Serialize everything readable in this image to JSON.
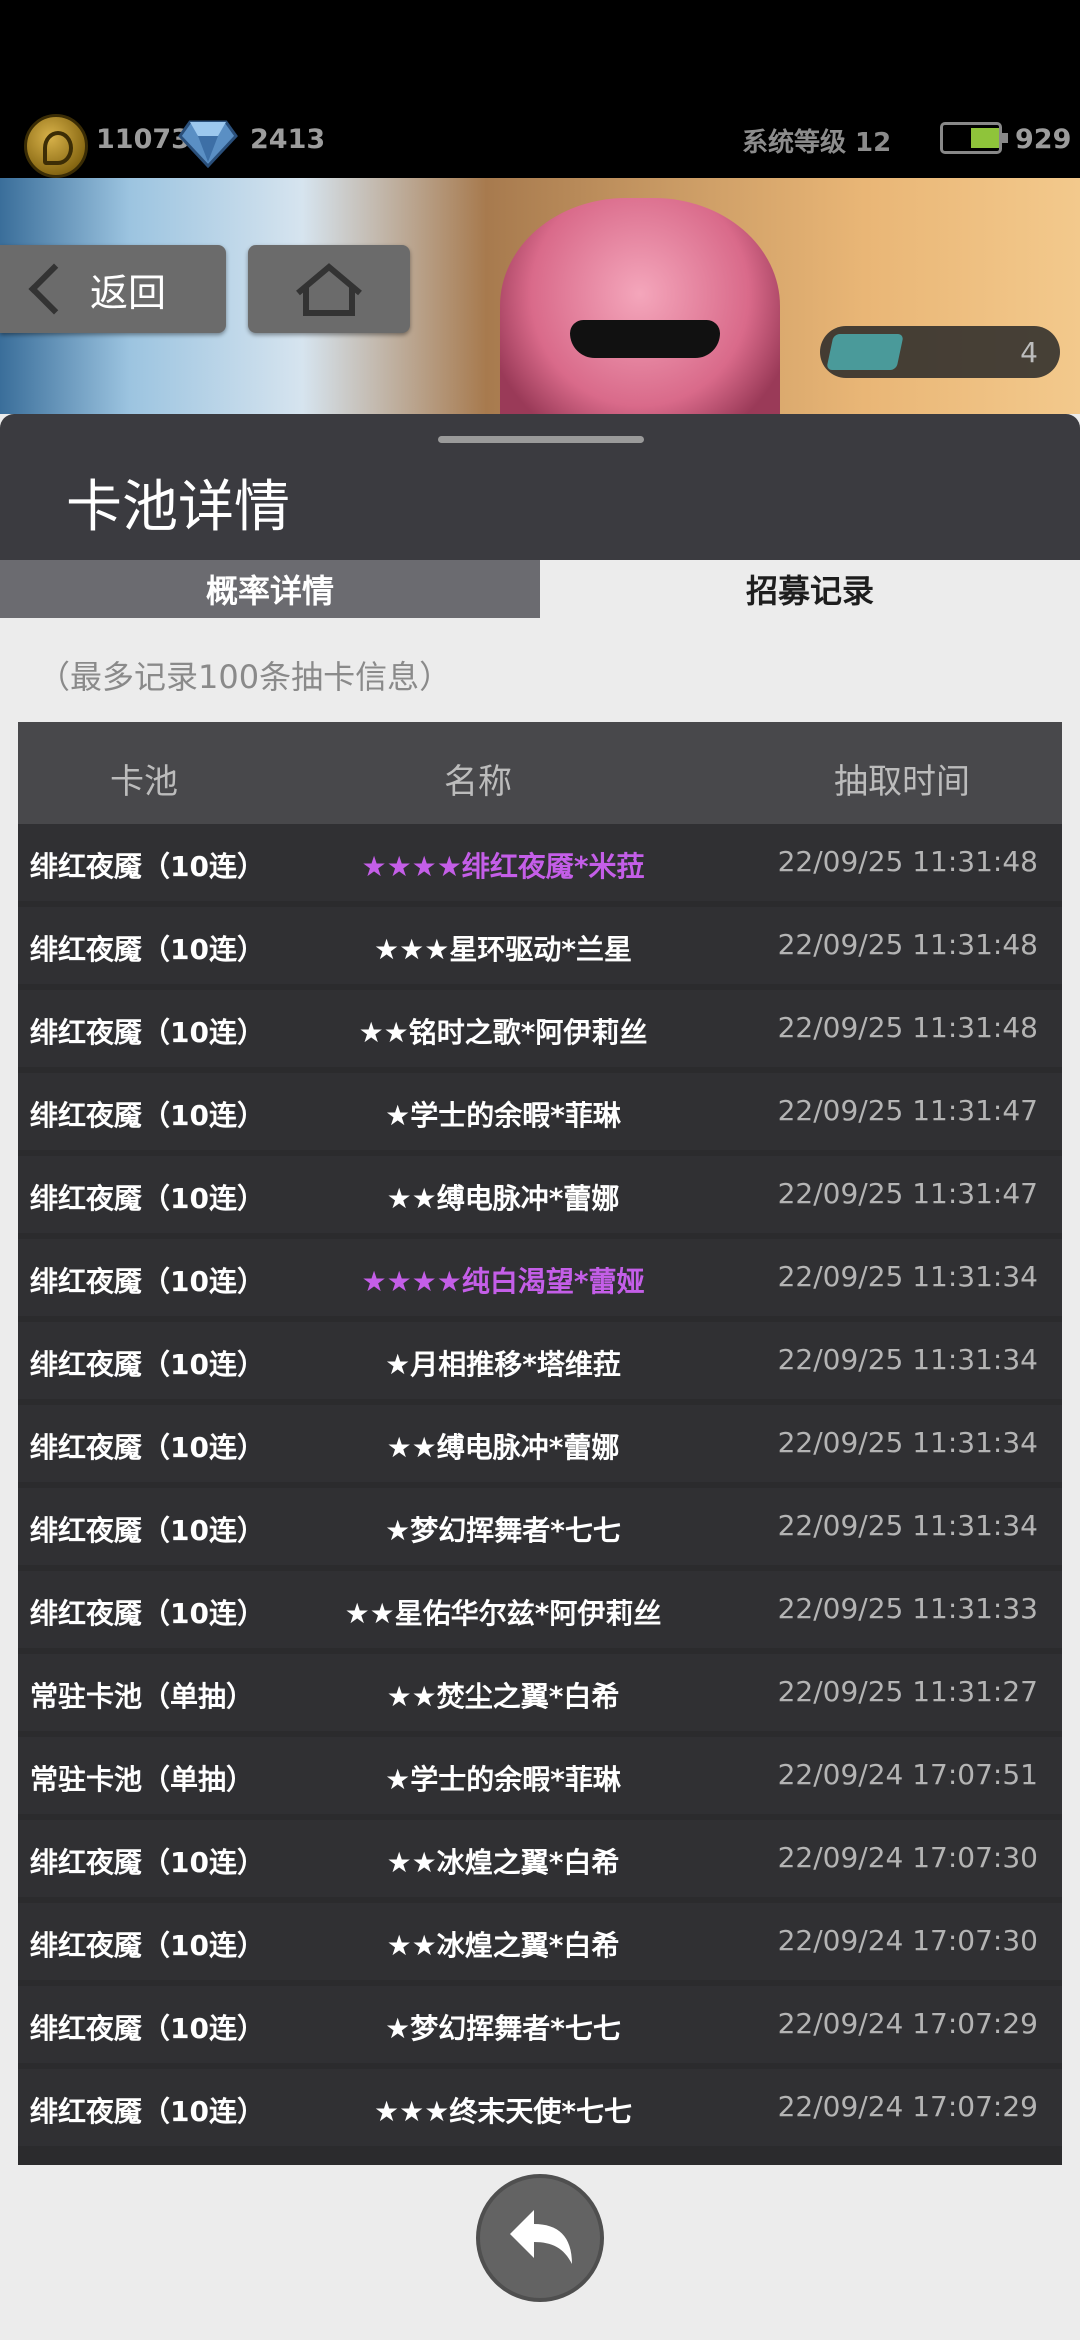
{
  "topbar": {
    "coins": "11073",
    "gems": "2413",
    "system_level": "系统等级 12",
    "energy": "929"
  },
  "banner": {
    "back_label": "返回",
    "ticket_count": "4"
  },
  "dialog": {
    "title": "卡池详情",
    "tabs": [
      "概率详情",
      "招募记录"
    ],
    "active_tab": "招募记录",
    "note": "（最多记录100条抽卡信息）"
  },
  "table": {
    "headers": [
      "卡池",
      "名称",
      "抽取时间"
    ],
    "rows": [
      {
        "pool": "绯红夜魇（10连）",
        "name": "★★★★绯红夜魇*米菈",
        "time": "22/09/25 11:31:48",
        "highlight": true
      },
      {
        "pool": "绯红夜魇（10连）",
        "name": "★★★星环驱动*兰星",
        "time": "22/09/25 11:31:48",
        "highlight": false
      },
      {
        "pool": "绯红夜魇（10连）",
        "name": "★★铭时之歌*阿伊莉丝",
        "time": "22/09/25 11:31:48",
        "highlight": false
      },
      {
        "pool": "绯红夜魇（10连）",
        "name": "★学士的余暇*菲琳",
        "time": "22/09/25 11:31:47",
        "highlight": false
      },
      {
        "pool": "绯红夜魇（10连）",
        "name": "★★缚电脉冲*蕾娜",
        "time": "22/09/25 11:31:47",
        "highlight": false
      },
      {
        "pool": "绯红夜魇（10连）",
        "name": "★★★★纯白渴望*蕾娅",
        "time": "22/09/25 11:31:34",
        "highlight": true
      },
      {
        "pool": "绯红夜魇（10连）",
        "name": "★月相推移*塔维菈",
        "time": "22/09/25 11:31:34",
        "highlight": false
      },
      {
        "pool": "绯红夜魇（10连）",
        "name": "★★缚电脉冲*蕾娜",
        "time": "22/09/25 11:31:34",
        "highlight": false
      },
      {
        "pool": "绯红夜魇（10连）",
        "name": "★梦幻挥舞者*七七",
        "time": "22/09/25 11:31:34",
        "highlight": false
      },
      {
        "pool": "绯红夜魇（10连）",
        "name": "★★星佑华尔兹*阿伊莉丝",
        "time": "22/09/25 11:31:33",
        "highlight": false
      },
      {
        "pool": "常驻卡池（单抽）",
        "name": "★★焚尘之翼*白希",
        "time": "22/09/25 11:31:27",
        "highlight": false
      },
      {
        "pool": "常驻卡池（单抽）",
        "name": "★学士的余暇*菲琳",
        "time": "22/09/24 17:07:51",
        "highlight": false
      },
      {
        "pool": "绯红夜魇（10连）",
        "name": "★★冰煌之翼*白希",
        "time": "22/09/24 17:07:30",
        "highlight": false
      },
      {
        "pool": "绯红夜魇（10连）",
        "name": "★★冰煌之翼*白希",
        "time": "22/09/24 17:07:30",
        "highlight": false
      },
      {
        "pool": "绯红夜魇（10连）",
        "name": "★梦幻挥舞者*七七",
        "time": "22/09/24 17:07:29",
        "highlight": false
      },
      {
        "pool": "绯红夜魇（10连）",
        "name": "★★★终末天使*七七",
        "time": "22/09/24 17:07:29",
        "highlight": false
      }
    ]
  }
}
